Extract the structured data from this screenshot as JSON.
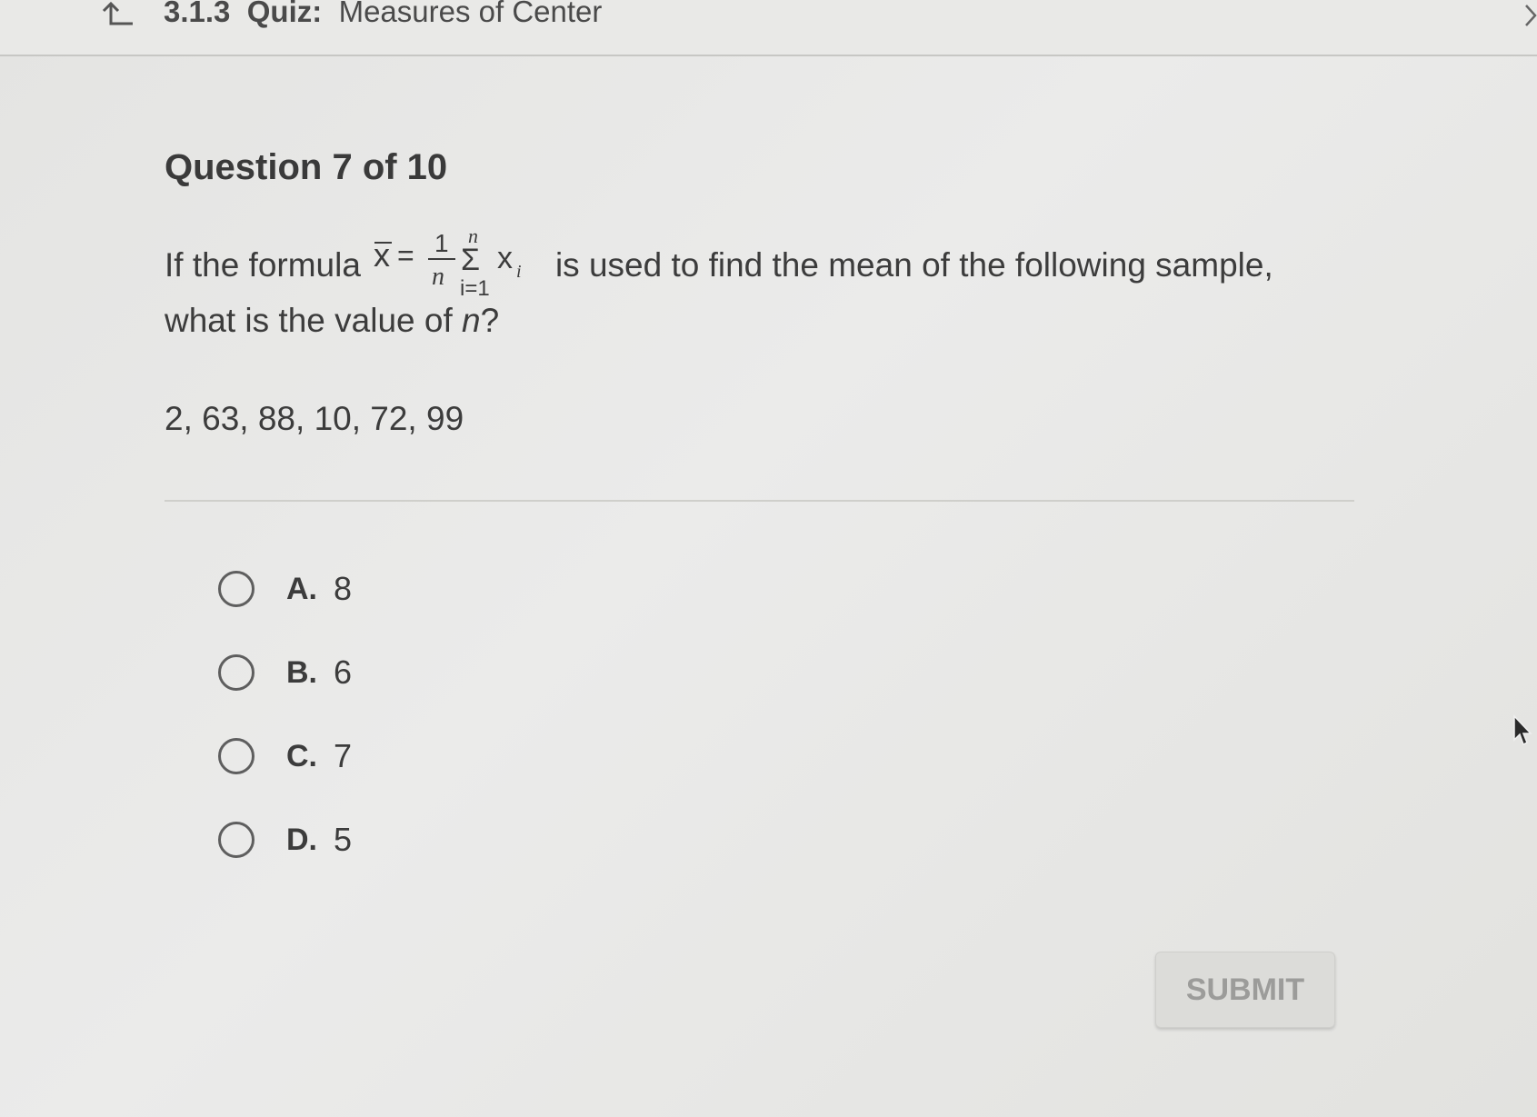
{
  "header": {
    "back_icon": "return-arrow-icon",
    "quiz_number": "3.1.3",
    "quiz_label": "Quiz:",
    "quiz_name": "Measures of Center",
    "next_icon": "chevron-right-icon"
  },
  "question": {
    "header": "Question 7 of 10",
    "prompt_before": "If the formula",
    "formula": {
      "lhs": "x̄",
      "equals": "=",
      "numerator": "1",
      "denominator": "n",
      "sum_upper": "n",
      "sum_symbol": "Σ",
      "sum_lower": "i=1",
      "term": "x",
      "term_sub": "i"
    },
    "prompt_after": "is used to find the mean of the following sample,",
    "prompt_line2_before": "what is the value of ",
    "prompt_line2_var": "n",
    "prompt_line2_after": "?",
    "sample": "2, 63, 88, 10, 72, 99"
  },
  "options": [
    {
      "letter": "A.",
      "value": "8"
    },
    {
      "letter": "B.",
      "value": "6"
    },
    {
      "letter": "C.",
      "value": "7"
    },
    {
      "letter": "D.",
      "value": "5"
    }
  ],
  "submit": {
    "label": "SUBMIT"
  },
  "colors": {
    "background": "#e8e8e6",
    "text": "#3c3c3c",
    "submit_text": "#9c9c9a"
  }
}
